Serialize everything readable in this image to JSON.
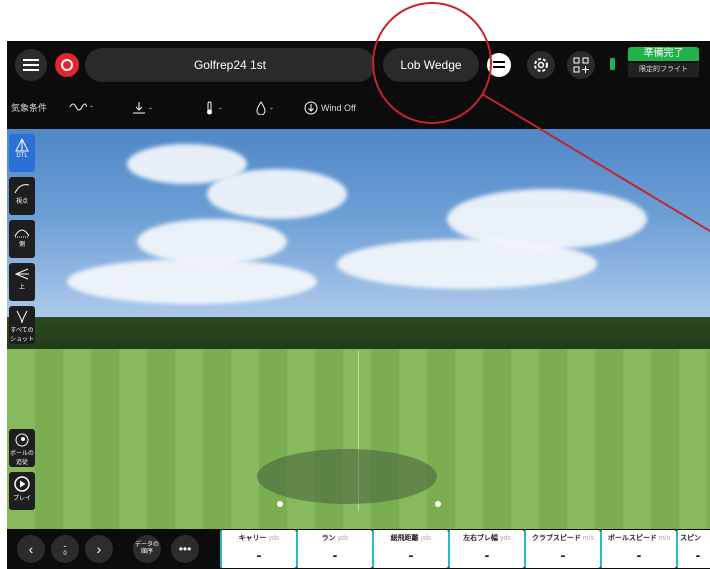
{
  "header": {
    "session_title": "Golfrep24 1st",
    "club": "Lob Wedge",
    "ready_label": "準備完了",
    "ready_sub": "限定的フライト"
  },
  "weather": {
    "label": "気象条件",
    "wind": "Wind Off",
    "dash": "-"
  },
  "tools": [
    {
      "label": "DTL",
      "icon": "dtl-icon"
    },
    {
      "label": "視点",
      "icon": "view-icon"
    },
    {
      "label": "側",
      "icon": "side-icon"
    },
    {
      "label": "上",
      "icon": "top-icon"
    },
    {
      "label": "すべてのショット",
      "icon": "all-shots-icon"
    },
    {
      "label": "ボールの追従",
      "icon": "ball-follow-icon"
    },
    {
      "label": "プレイ",
      "icon": "play-icon"
    }
  ],
  "bottom": {
    "shot_number": "-",
    "shot_sub": "0",
    "data_order": "データの順序",
    "metrics": [
      {
        "label": "キャリー",
        "unit": "yds",
        "value": "-"
      },
      {
        "label": "ラン",
        "unit": "yds",
        "value": "-"
      },
      {
        "label": "総飛距離",
        "unit": "yds",
        "value": "-"
      },
      {
        "label": "左右ブレ幅",
        "unit": "yds",
        "value": "-"
      },
      {
        "label": "クラブスピード",
        "unit": "m/s",
        "value": "-"
      },
      {
        "label": "ボールスピード",
        "unit": "m/s",
        "value": "-"
      },
      {
        "label": "スピン",
        "unit": "",
        "value": "-"
      }
    ]
  },
  "colors": {
    "accent": "#2c6fd6",
    "ready": "#22b24c",
    "annotation": "#c0272d",
    "metric_border": "#2bb5c8"
  }
}
